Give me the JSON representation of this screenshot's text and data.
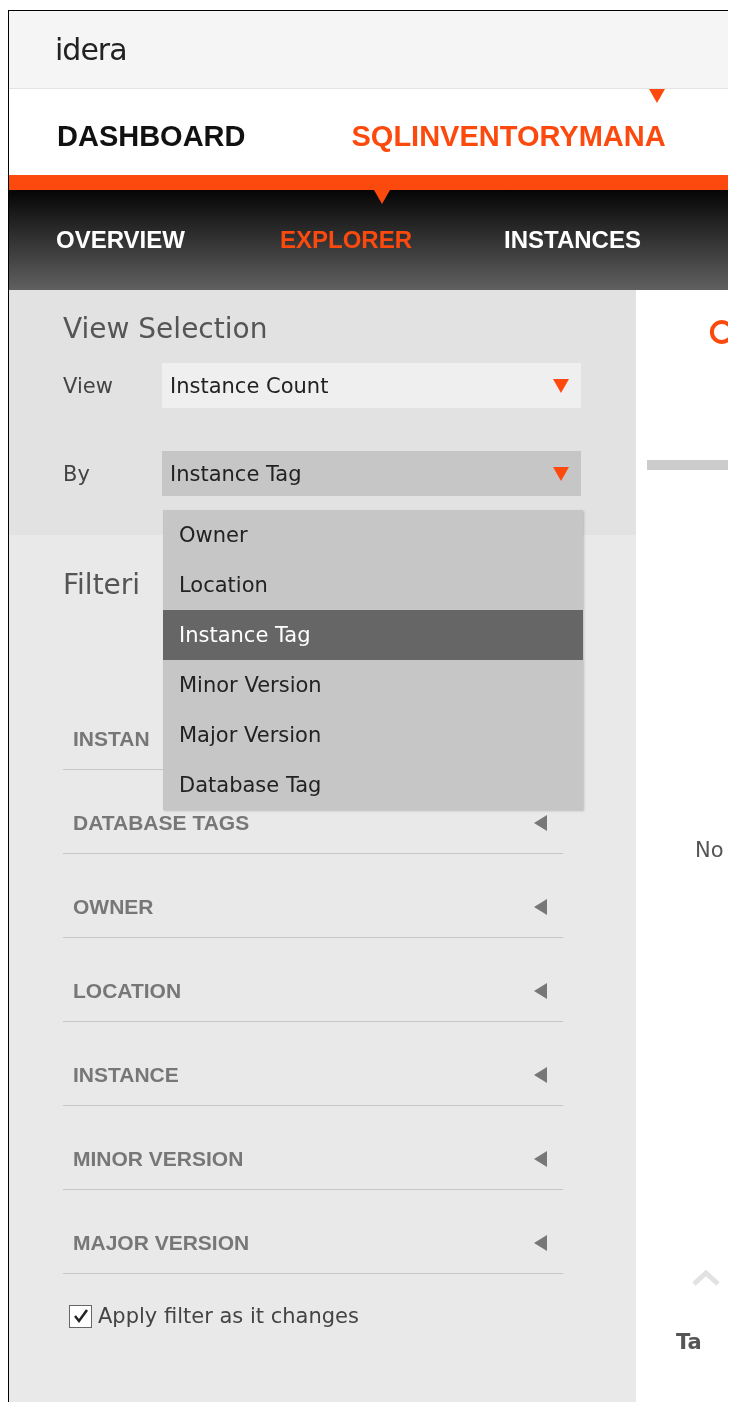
{
  "logo": "idera",
  "top_nav": {
    "items": [
      {
        "label": "DASHBOARD",
        "selected": false
      },
      {
        "label": "SQLINVENTORYMANA",
        "selected": true
      }
    ]
  },
  "sub_nav": {
    "tabs": [
      {
        "label": "OVERVIEW",
        "selected": false
      },
      {
        "label": "EXPLORER",
        "selected": true
      },
      {
        "label": "INSTANCES",
        "selected": false
      }
    ]
  },
  "view_selection": {
    "title": "View Selection",
    "fields": [
      {
        "label": "View",
        "value": "Instance Count",
        "expanded": false
      },
      {
        "label": "By",
        "value": "Instance Tag",
        "expanded": true
      }
    ]
  },
  "dropdown": {
    "options": [
      {
        "label": "Owner",
        "selected": false
      },
      {
        "label": "Location",
        "selected": false
      },
      {
        "label": "Instance Tag",
        "selected": true
      },
      {
        "label": "Minor Version",
        "selected": false
      },
      {
        "label": "Major Version",
        "selected": false
      },
      {
        "label": "Database Tag",
        "selected": false
      }
    ]
  },
  "filtering": {
    "title": "Filteri",
    "sections": [
      {
        "label": "INSTAN"
      },
      {
        "label": "DATABASE TAGS"
      },
      {
        "label": "OWNER"
      },
      {
        "label": "LOCATION"
      },
      {
        "label": "INSTANCE"
      },
      {
        "label": "MINOR VERSION"
      },
      {
        "label": "MAJOR VERSION"
      }
    ]
  },
  "apply_filter": {
    "label": "Apply filter as it changes",
    "checked": true
  },
  "right_panel": {
    "texts": [
      "No",
      "Ta"
    ]
  }
}
